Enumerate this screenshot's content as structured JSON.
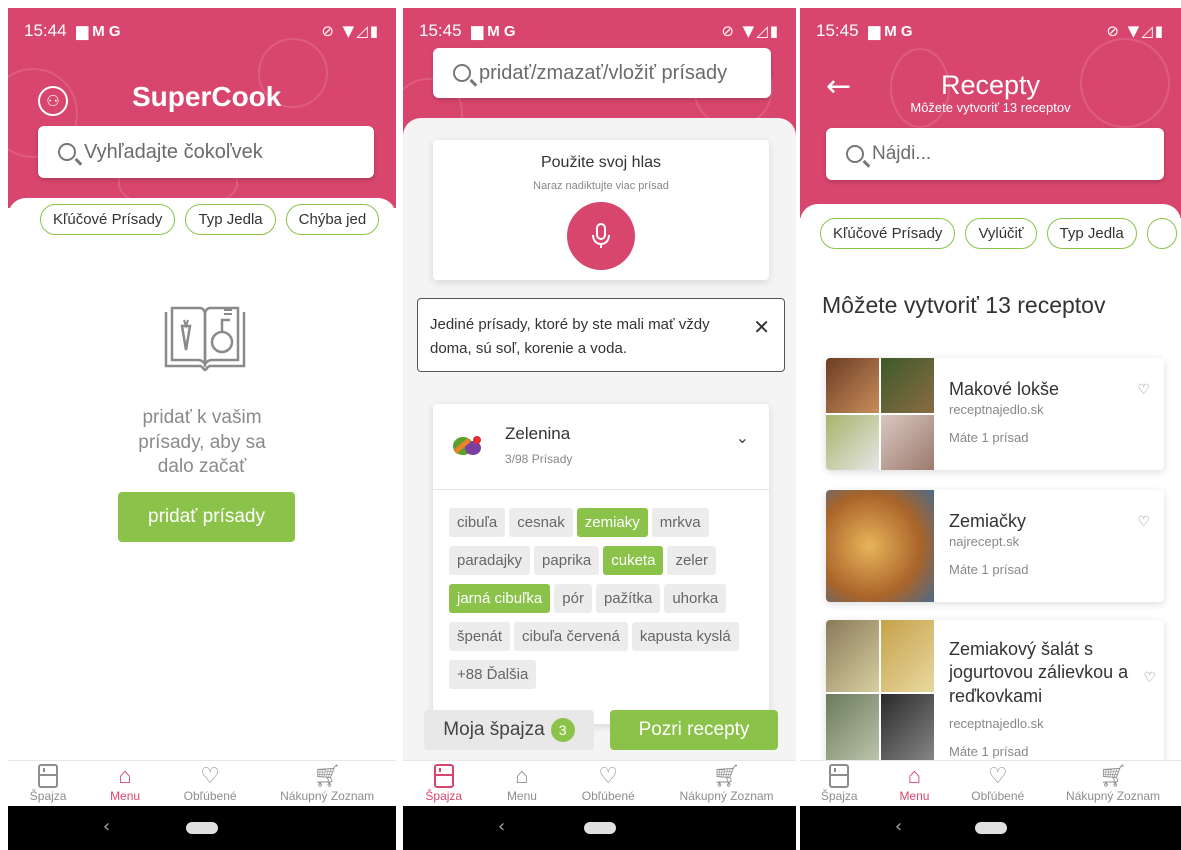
{
  "status": [
    {
      "time": "15:44",
      "icons": "▆ M G",
      "right": "⊘ ▼◿▮"
    },
    {
      "time": "15:45",
      "icons": "▆ M G",
      "right": "⊘ ▼◿▮"
    },
    {
      "time": "15:45",
      "icons": "▆ M G",
      "right": "⊘ ▼◿▮"
    }
  ],
  "screen1": {
    "app_title": "SuperCook",
    "search_placeholder": "Vyhľadajte čokoľvek",
    "chips": [
      "Kľúčové Prísady",
      "Typ Jedla",
      "Chýba jed"
    ],
    "empty_text": "pridať k vašim prísady, aby sa dalo začať",
    "add_button": "pridať prísady"
  },
  "screen2": {
    "search_placeholder": "pridať/zmazať/vložiť prísady",
    "voice_title": "Použite svoj hlas",
    "voice_subtitle": "Naraz nadiktujte viac prísad",
    "info_text": "Jediné prísady, ktoré by ste mali mať vždy doma, sú soľ, korenie a voda.",
    "category_name": "Zelenina",
    "category_count": "3/98 Prísady",
    "ingredients": [
      {
        "label": "cibuľa",
        "selected": false
      },
      {
        "label": "cesnak",
        "selected": false
      },
      {
        "label": "zemiaky",
        "selected": true
      },
      {
        "label": "mrkva",
        "selected": false
      },
      {
        "label": "paradajky",
        "selected": false
      },
      {
        "label": "paprika",
        "selected": false
      },
      {
        "label": "cuketa",
        "selected": true
      },
      {
        "label": "zeler",
        "selected": false
      },
      {
        "label": "jarná cibuľka",
        "selected": true
      },
      {
        "label": "pór",
        "selected": false
      },
      {
        "label": "pažítka",
        "selected": false
      },
      {
        "label": "uhorka",
        "selected": false
      },
      {
        "label": "špenát",
        "selected": false
      },
      {
        "label": "cibuľa červená",
        "selected": false
      },
      {
        "label": "kapusta kyslá",
        "selected": false
      },
      {
        "label": "+88 Ďalšia",
        "selected": false
      }
    ],
    "pantry_button": "Moja špajza",
    "pantry_count": "3",
    "recipes_button": "Pozri recepty"
  },
  "screen3": {
    "title": "Recepty",
    "subtitle": "Môžete vytvoriť 13 receptov",
    "search_placeholder": "Nájdi...",
    "chips": [
      "Kľúčové Prísady",
      "Vylúčiť",
      "Typ Jedla"
    ],
    "heading": "Môžete vytvoriť 13 receptov",
    "recipes": [
      {
        "title": "Makové lokše",
        "source": "receptnajedlo.sk",
        "have": "Máte 1 prísad"
      },
      {
        "title": "Zemiačky",
        "source": "najrecept.sk",
        "have": "Máte 1 prísad"
      },
      {
        "title": "Zemiakový šalát s jogurtovou zálievkou a reďkovkami",
        "source": "receptnajedlo.sk",
        "have": "Máte 1 prísad"
      }
    ]
  },
  "nav": {
    "items": [
      "Špajza",
      "Menu",
      "Obľúbené",
      "Nákupný Zoznam"
    ]
  },
  "colors": {
    "brand": "#d9466d",
    "accent": "#8bc34a"
  }
}
